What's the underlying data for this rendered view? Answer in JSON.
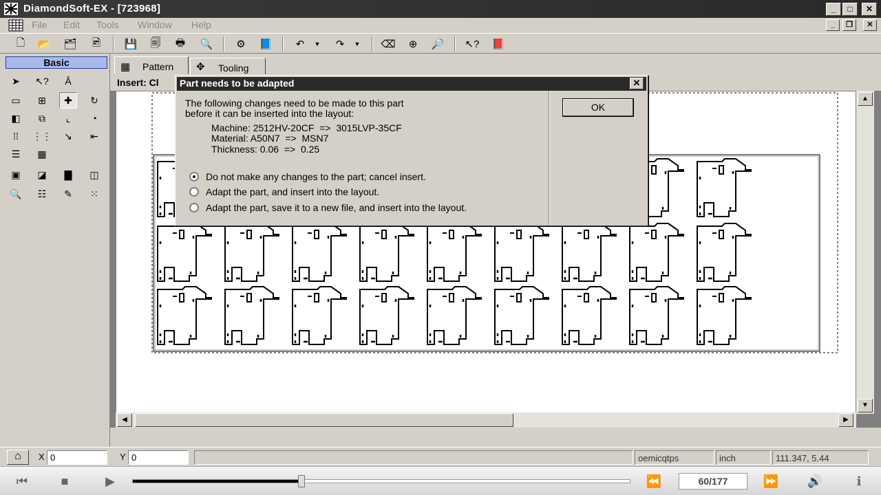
{
  "window": {
    "title": "DiamondSoft-EX - [723968]"
  },
  "menu": [
    "File",
    "Edit",
    "Tools",
    "Window",
    "Help"
  ],
  "left_panel": {
    "header": "Basic"
  },
  "tabs": [
    {
      "label": "Pattern"
    },
    {
      "label": "Tooling"
    }
  ],
  "insert_bar": {
    "label": "Insert: Cl"
  },
  "dialog": {
    "title": "Part needs to be adapted",
    "intro_line1": "The following changes need to be made to this part",
    "intro_line2": "before it can be inserted into the layout:",
    "machine": "Machine: 2512HV-20CF  =>  3015LVP-35CF",
    "material": "Material: A50N7  =>  MSN7",
    "thickness": "Thickness: 0.06  =>  0.25",
    "options": [
      "Do not make any changes to the part; cancel insert.",
      "Adapt the part, and insert into the layout.",
      "Adapt the part, save it to a new file, and insert into the layout."
    ],
    "selected_option": 0,
    "ok_label": "OK"
  },
  "status": {
    "x_label": "X",
    "x_value": "0",
    "y_label": "Y",
    "y_value": "0",
    "user": "oemicqtps",
    "units": "inch",
    "coords": "111.347, 5.44"
  },
  "player": {
    "position": "60/177",
    "current_frame": 60,
    "total_frames": 177
  }
}
